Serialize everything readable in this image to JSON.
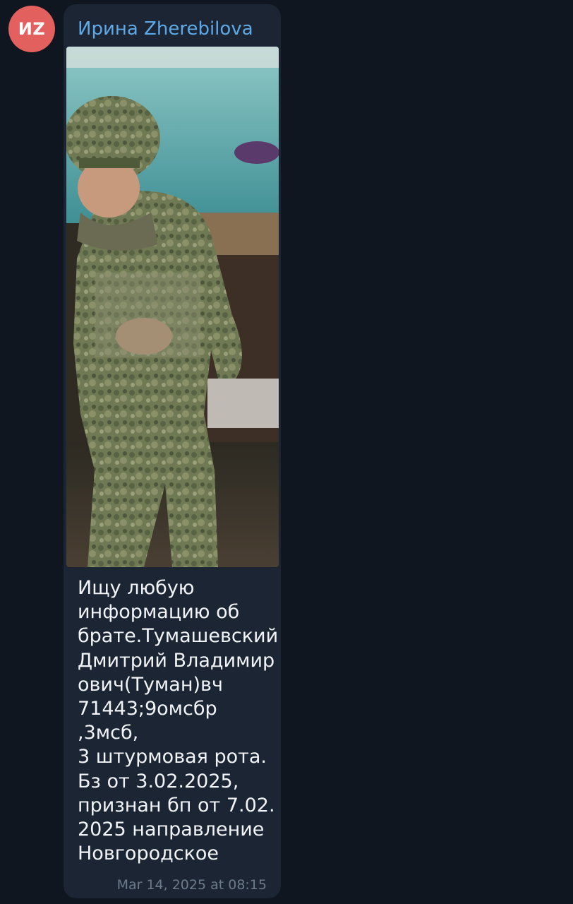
{
  "message": {
    "avatar_initials": "ИZ",
    "sender_name": "Ирина Zherebilova",
    "text": "Ищу любую\nинформацию об\nбрате.Тумашевский\nДмитрий Владимир\nович(Туман)вч\n71443;9омсбр ,3мсб,\n3 штурмовая рота.\nБз от 3.02.2025,\nпризнан бп от 7.02.\n2025 направление\nНовгородское",
    "timestamp": "Mar 14, 2025 at 08:15",
    "photo": "soldier-in-camouflage-photo"
  },
  "colors": {
    "background": "#0f1620",
    "bubble": "#1b2533",
    "avatar": "#e2605d",
    "sender": "#5fa8e6",
    "text": "#f2f4f7",
    "timestamp": "#6c7a8b"
  }
}
